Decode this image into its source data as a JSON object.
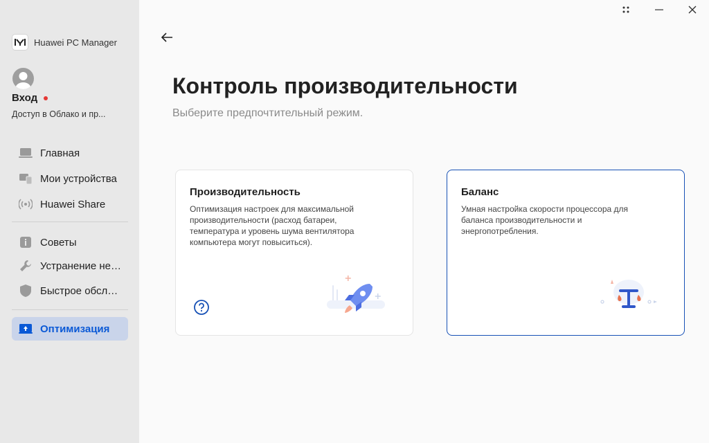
{
  "app": {
    "title": "Huawei PC Manager"
  },
  "account": {
    "login_label": "Вход",
    "login_sub": "Доступ в Облако и пр..."
  },
  "sidebar": {
    "items": [
      {
        "label": "Главная",
        "icon": "laptop-icon"
      },
      {
        "label": "Мои устройства",
        "icon": "devices-icon"
      },
      {
        "label": "Huawei Share",
        "icon": "share-icon"
      },
      {
        "label": "Советы",
        "icon": "tips-icon"
      },
      {
        "label": "Устранение неполадок",
        "icon": "wrench-icon"
      },
      {
        "label": "Быстрое обслуживание",
        "icon": "shield-icon"
      },
      {
        "label": "Оптимизация",
        "icon": "optimization-icon",
        "active": true
      }
    ]
  },
  "main": {
    "title": "Контроль производительности",
    "subtitle": "Выберите предпочтительный режим.",
    "cards": [
      {
        "title": "Производительность",
        "description": "Оптимизация настроек для максимальной производительности (расход батареи, температура и уровень шума вентилятора компьютера могут повыситься).",
        "selected": false
      },
      {
        "title": "Баланс",
        "description": "Умная настройка скорости процессора для баланса производительности и энергопотребления.",
        "selected": true
      }
    ]
  },
  "colors": {
    "accent": "#0a59d6",
    "selected_border": "#1650b5",
    "sidebar_bg": "#e8e8e8",
    "active_bg": "#c9d4ea"
  }
}
